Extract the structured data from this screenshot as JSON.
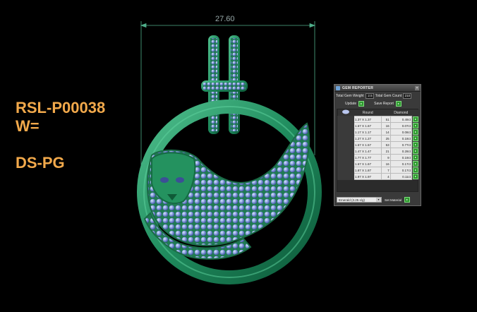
{
  "labels": {
    "code": "RSL-P00038",
    "weight": "W=",
    "finish": "DS-PG"
  },
  "dimension": {
    "value": "27.60"
  },
  "gem_reporter": {
    "title": "GEM REPORTER",
    "total_gem_weight_label": "Total Gem Weight",
    "total_gem_weight_value": "2.5",
    "total_gem_count_label": "Total Gem Count",
    "total_gem_count_value": "210",
    "update_label": "Update",
    "save_report_label": "Save Report",
    "headers": [
      "Round",
      "Diamond"
    ],
    "rows": [
      {
        "size": "1.37 X 1.37",
        "count": "51",
        "weight": "0.49ct"
      },
      {
        "size": "1.67 X 1.67",
        "count": "16",
        "weight": "0.07ct"
      },
      {
        "size": "1.17 X 1.17",
        "count": "14",
        "weight": "0.08ct"
      },
      {
        "size": "1.27 X 1.27",
        "count": "25",
        "weight": "0.18ct"
      },
      {
        "size": "1.57 X 1.57",
        "count": "53",
        "weight": "0.77ct"
      },
      {
        "size": "1.47 X 1.47",
        "count": "21",
        "weight": "0.28ct"
      },
      {
        "size": "1.77 X 1.77",
        "count": "9",
        "weight": "0.19ct"
      },
      {
        "size": "1.67 X 1.67",
        "count": "16",
        "weight": "0.17ct"
      },
      {
        "size": "1.87 X 1.87",
        "count": "7",
        "weight": "0.17ct"
      },
      {
        "size": "1.97 X 1.97",
        "count": "4",
        "weight": "0.11ct"
      }
    ],
    "material_select": "Emerald     (3.25 s/g)",
    "set_material_label": "Set Material"
  }
}
